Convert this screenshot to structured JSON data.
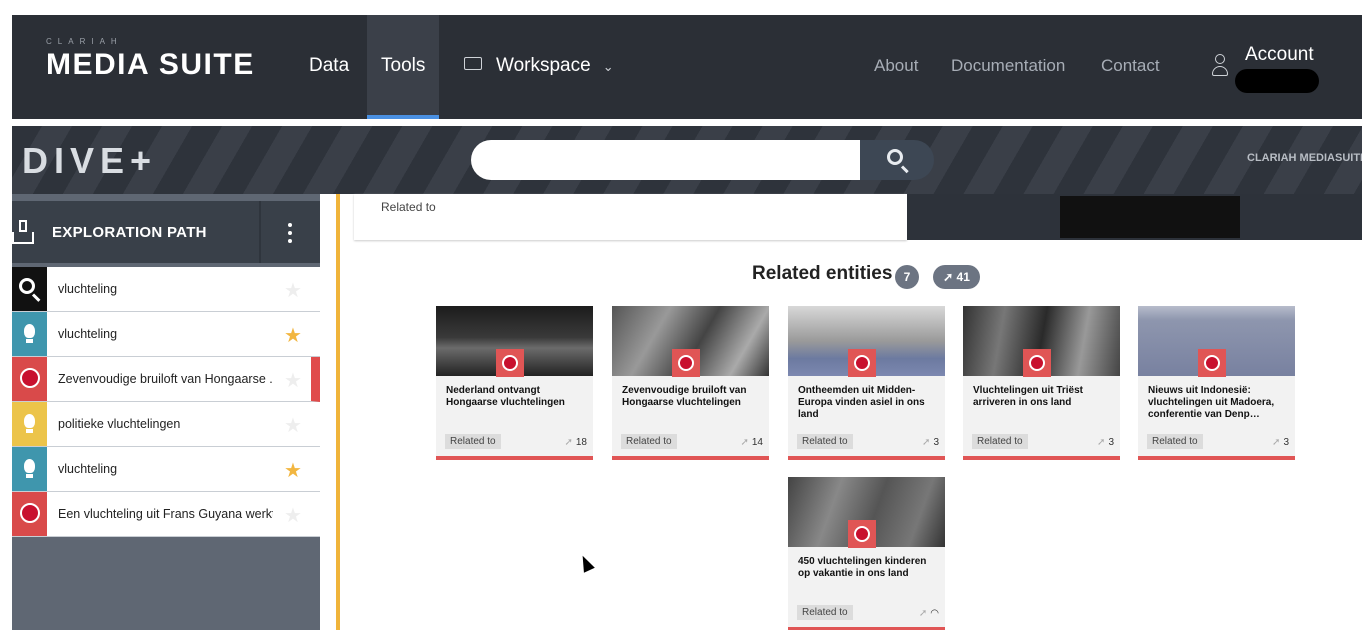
{
  "nav": {
    "brand_small": "CLARIAH",
    "brand_main": "MEDIA SUITE",
    "data": "Data",
    "tools": "Tools",
    "workspace": "Workspace",
    "about": "About",
    "documentation": "Documentation",
    "contact": "Contact",
    "account": "Account"
  },
  "dive": {
    "logo": "DIVE+",
    "search_value": "",
    "clariah_link": "CLARIAH MEDIASUITE"
  },
  "sidebar": {
    "title": "EXPLORATION PATH",
    "items": [
      {
        "label": "vluchteling",
        "icon": "search-icon",
        "starred": false
      },
      {
        "label": "vluchteling",
        "icon": "bulb-icon",
        "starred": true
      },
      {
        "label": "Zevenvoudige bruiloft van Hongaarse ...",
        "icon": "video-icon",
        "starred": false,
        "active": true
      },
      {
        "label": "politieke vluchtelingen",
        "icon": "bulb-icon",
        "starred": false
      },
      {
        "label": "vluchteling",
        "icon": "bulb-icon",
        "starred": true
      },
      {
        "label": "Een vluchteling uit Frans Guyana werkt i...",
        "icon": "video-icon",
        "starred": false
      }
    ]
  },
  "main": {
    "tab_label": "Related to",
    "entities_title": "Related entities",
    "entities_count": "7",
    "links_count": "41",
    "cards": [
      {
        "title": "Nederland ontvangt Hongaarse vluchtelingen",
        "chip": "Related to",
        "count": "18"
      },
      {
        "title": "Zevenvoudige bruiloft van Hongaarse vluchtelingen",
        "chip": "Related to",
        "count": "14"
      },
      {
        "title": "Ontheemden uit Midden-Europa vinden asiel in ons land",
        "chip": "Related to",
        "count": "3"
      },
      {
        "title": "Vluchtelingen uit Triëst arriveren in ons land",
        "chip": "Related to",
        "count": "3"
      },
      {
        "title": "Nieuws uit Indonesië: vluchtelingen uit Madoera, conferentie van Denp…",
        "chip": "Related to",
        "count": "3"
      },
      {
        "title": "450 vluchtelingen kinderen op vakantie in ons land",
        "chip": "Related to",
        "count": ""
      }
    ]
  },
  "colors": {
    "nav_bg": "#2b2f36",
    "accent_blue": "#4a90e2",
    "entity_red": "#e05555",
    "star_yellow": "#f2b640",
    "stripe_orange": "#f0b43a"
  }
}
